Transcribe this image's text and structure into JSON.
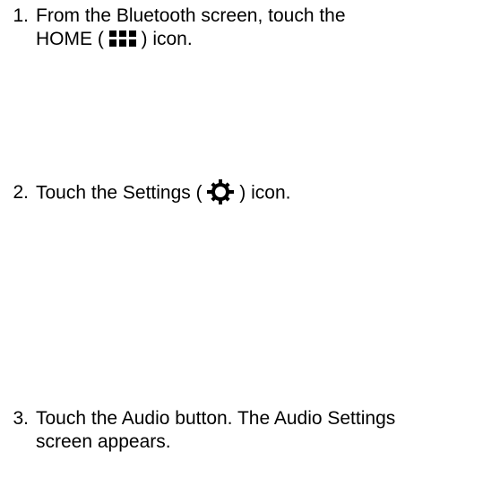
{
  "steps": [
    {
      "number": "1.",
      "text_before": "From the Bluetooth screen, touch the",
      "text_line2_before": "HOME ( ",
      "icon": "home-grid-icon",
      "text_after": " ) icon."
    },
    {
      "number": "2.",
      "text_before": "Touch the Settings ( ",
      "icon": "settings-gear-icon",
      "text_after": " ) icon."
    },
    {
      "number": "3.",
      "text_line1": "Touch the Audio button. The Audio Settings",
      "text_line2": "screen appears."
    }
  ]
}
